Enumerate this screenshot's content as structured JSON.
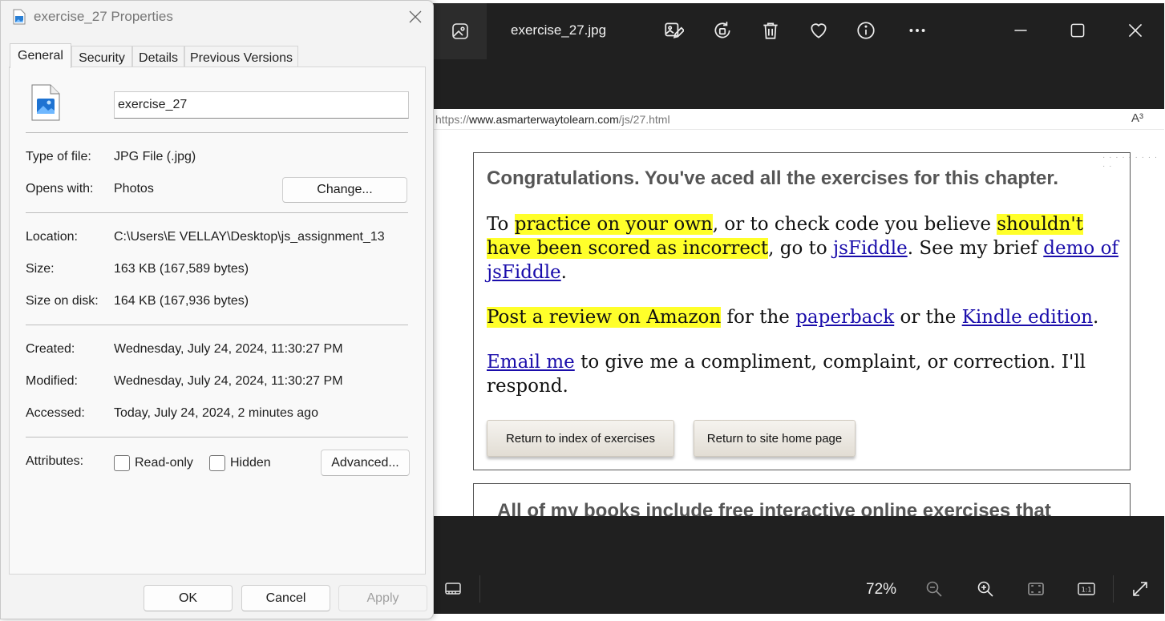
{
  "dialog": {
    "title": "exercise_27 Properties",
    "tabs": [
      {
        "label": "General",
        "active": true
      },
      {
        "label": "Security"
      },
      {
        "label": "Details"
      },
      {
        "label": "Previous Versions"
      }
    ],
    "file_name_value": "exercise_27",
    "type_label": "Type of file:",
    "type_value": "JPG File (.jpg)",
    "opens_label": "Opens with:",
    "opens_value": "Photos",
    "change_button": "Change...",
    "location_label": "Location:",
    "location_value": "C:\\Users\\E VELLAY\\Desktop\\js_assignment_13",
    "size_label": "Size:",
    "size_value": "163 KB (167,589 bytes)",
    "size_on_disk_label": "Size on disk:",
    "size_on_disk_value": "164 KB (167,936 bytes)",
    "created_label": "Created:",
    "created_value": "Wednesday, July 24, 2024, 11:30:27 PM",
    "modified_label": "Modified:",
    "modified_value": "Wednesday, July 24, 2024, 11:30:27 PM",
    "accessed_label": "Accessed:",
    "accessed_value": "Today, July 24, 2024, 2 minutes ago",
    "attributes_label": "Attributes:",
    "readonly_label": "Read-only",
    "readonly_checked": false,
    "hidden_label": "Hidden",
    "hidden_checked": false,
    "advanced_button": "Advanced...",
    "ok_button": "OK",
    "cancel_button": "Cancel",
    "apply_button": "Apply"
  },
  "viewer": {
    "file_title": "exercise_27.jpg",
    "zoom_level": "72%",
    "toolbar_icons": [
      "gallery-icon",
      "edit-image-icon",
      "rotate-icon",
      "delete-icon",
      "favorite-heart-icon",
      "info-icon",
      "more-icon"
    ],
    "window_controls": [
      "minimize-icon",
      "maximize-icon",
      "close-icon"
    ],
    "bottom_icons": [
      "filmstrip-icon",
      "zoom-out-icon",
      "zoom-in-icon",
      "fit-to-window-icon",
      "actual-size-icon",
      "fullscreen-icon"
    ],
    "image_content": {
      "url_prefix": "https://",
      "url_domain": "www.asmarterwaytolearn.com",
      "url_path": "/js/27.html",
      "read_aloud": "A³",
      "congrats": "Congratulations. You've aced all the exercises for this chapter.",
      "p1_pre": "To ",
      "p1_hl1": "practice on your own",
      "p1_mid": ", or to check code you believe ",
      "p1_hl2": "shouldn't have been scored as incorrect",
      "p1_mid2": ", go to ",
      "p1_link1": "jsFiddle",
      "p1_mid3": ". See my brief ",
      "p1_link2": "demo of jsFiddle",
      "p1_end": ".",
      "p2_hl": "Post a review on Amazon",
      "p2_mid": " for the ",
      "p2_link1": "paperback",
      "p2_mid2": " or the ",
      "p2_link2": "Kindle edition",
      "p2_end": ".",
      "p3_link": "Email me",
      "p3_text": " to give me a compliment, complaint, or correction. I'll respond.",
      "btn_index": "Return to index of exercises",
      "btn_home": "Return to site home page",
      "books_text": "All of my books include free interactive online exercises that"
    },
    "colors": {
      "highlight": "#ffff2a",
      "link": "#1a0dab",
      "viewer_bg": "#202020"
    }
  }
}
